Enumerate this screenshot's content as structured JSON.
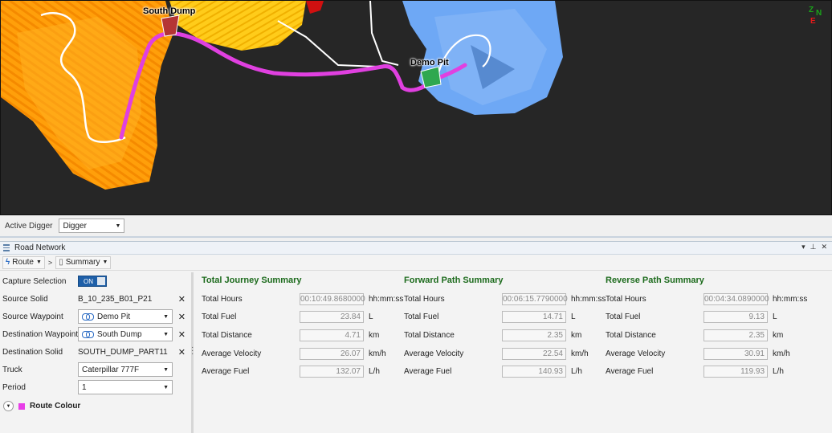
{
  "map": {
    "labels": {
      "south_dump": "South Dump",
      "demo_pit": "Demo Pit"
    },
    "compass": {
      "z": "Z",
      "n": "N",
      "e": "E"
    },
    "colors": {
      "route": "#e040e0",
      "dump": "#ffa500",
      "pit": "#6ea8f5",
      "background": "#262626"
    }
  },
  "digger_bar": {
    "label": "Active Digger",
    "value": "Digger"
  },
  "panel": {
    "title": "Road Network"
  },
  "toolbar": {
    "route_label": "Route",
    "summary_label": "Summary",
    "separator": ">"
  },
  "left": {
    "capture_selection": {
      "label": "Capture Selection",
      "value": "ON"
    },
    "source_solid": {
      "label": "Source Solid",
      "value": "B_10_235_B01_P21"
    },
    "source_waypoint": {
      "label": "Source Waypoint",
      "value": "Demo Pit"
    },
    "destination_waypoint": {
      "label": "Destination Waypoint",
      "value": "South Dump"
    },
    "destination_solid": {
      "label": "Destination Solid",
      "value": "SOUTH_DUMP_PART11"
    },
    "truck": {
      "label": "Truck",
      "value": "Caterpillar 777F"
    },
    "period": {
      "label": "Period",
      "value": "1"
    },
    "route_colour": {
      "label": "Route Colour",
      "color": "#e83ee8"
    }
  },
  "summaries": [
    {
      "title": "Total Journey Summary",
      "rows": [
        {
          "label": "Total Hours",
          "value": "00:10:49.8680000",
          "unit": "hh:mm:ss"
        },
        {
          "label": "Total Fuel",
          "value": "23.84",
          "unit": "L"
        },
        {
          "label": "Total Distance",
          "value": "4.71",
          "unit": "km"
        },
        {
          "label": "Average Velocity",
          "value": "26.07",
          "unit": "km/h"
        },
        {
          "label": "Average Fuel",
          "value": "132.07",
          "unit": "L/h"
        }
      ]
    },
    {
      "title": "Forward Path Summary",
      "rows": [
        {
          "label": "Total Hours",
          "value": "00:06:15.7790000",
          "unit": "hh:mm:ss"
        },
        {
          "label": "Total Fuel",
          "value": "14.71",
          "unit": "L"
        },
        {
          "label": "Total Distance",
          "value": "2.35",
          "unit": "km"
        },
        {
          "label": "Average Velocity",
          "value": "22.54",
          "unit": "km/h"
        },
        {
          "label": "Average Fuel",
          "value": "140.93",
          "unit": "L/h"
        }
      ]
    },
    {
      "title": "Reverse Path Summary",
      "rows": [
        {
          "label": "Total Hours",
          "value": "00:04:34.0890000",
          "unit": "hh:mm:ss"
        },
        {
          "label": "Total Fuel",
          "value": "9.13",
          "unit": "L"
        },
        {
          "label": "Total Distance",
          "value": "2.35",
          "unit": "km"
        },
        {
          "label": "Average Velocity",
          "value": "30.91",
          "unit": "km/h"
        },
        {
          "label": "Average Fuel",
          "value": "119.93",
          "unit": "L/h"
        }
      ]
    }
  ]
}
